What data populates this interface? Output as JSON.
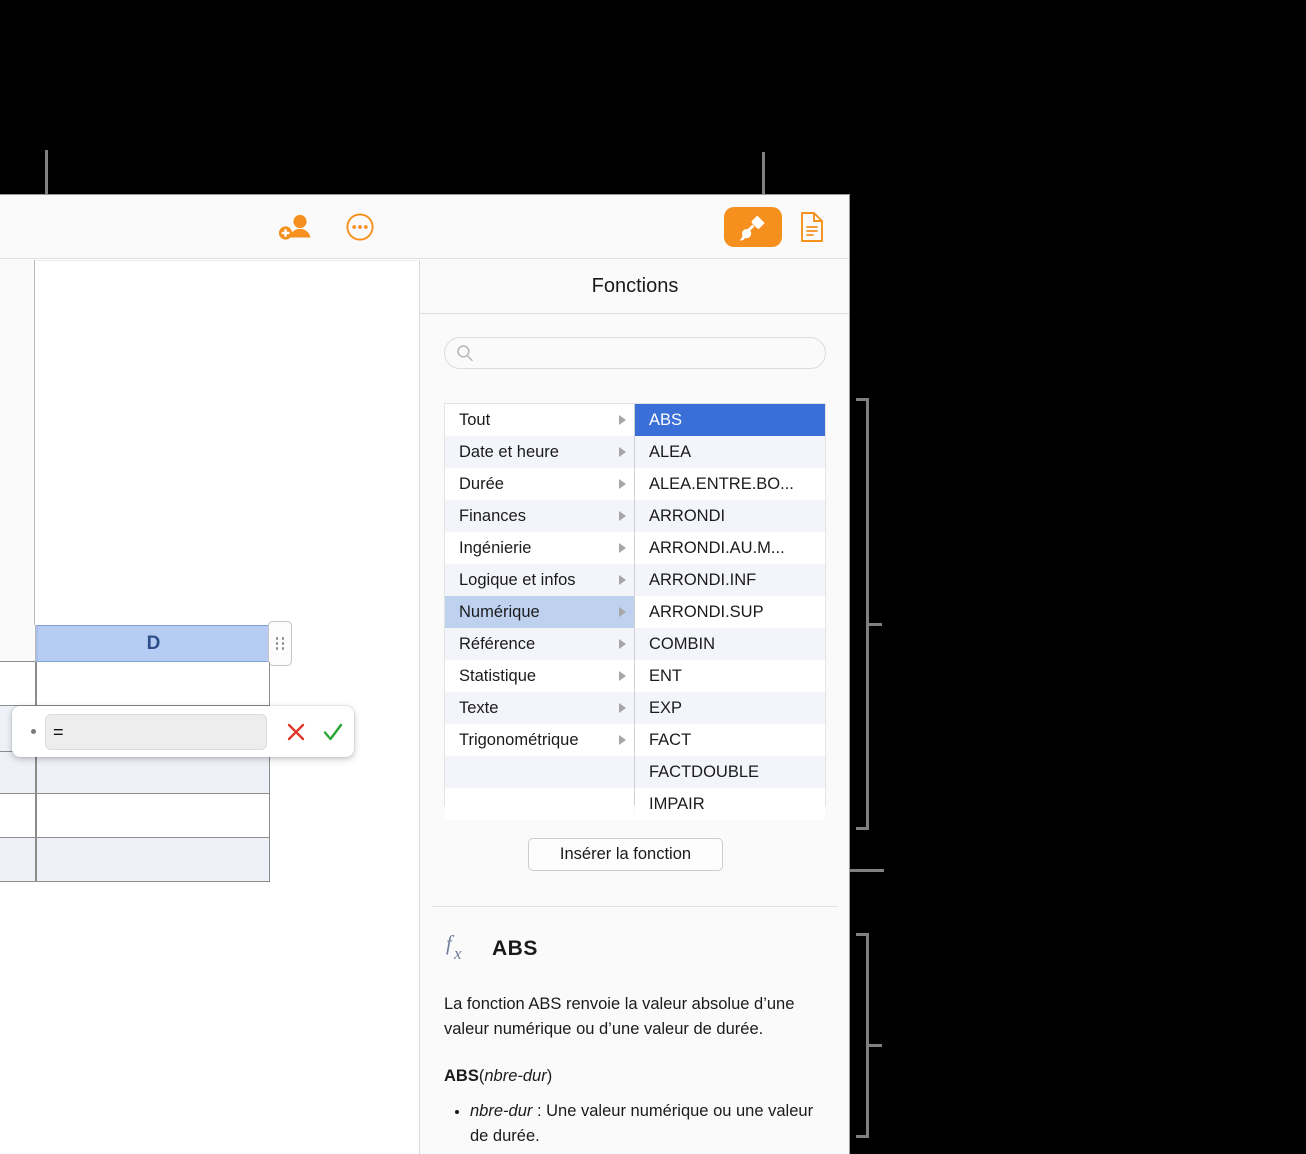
{
  "toolbar": {
    "share_icon": "add-person-icon",
    "more_icon": "ellipsis-circle-icon",
    "format_icon": "paintbrush-icon",
    "document_icon": "document-icon"
  },
  "sheet": {
    "selected_column_label": "D",
    "column_handle_icon": "drag-dots-icon"
  },
  "formula_editor": {
    "value": "=",
    "cancel_icon": "x-mark-icon",
    "accept_icon": "checkmark-icon",
    "cancel_color": "#e0392e",
    "accept_color": "#2aa535"
  },
  "panel": {
    "title": "Fonctions",
    "search": {
      "placeholder": "",
      "value": "",
      "icon": "search-icon"
    },
    "categories": [
      "Tout",
      "Date et heure",
      "Durée",
      "Finances",
      "Ingénierie",
      "Logique et infos",
      "Numérique",
      "Référence",
      "Statistique",
      "Texte",
      "Trigonométrique"
    ],
    "selected_category": "Numérique",
    "functions": [
      "ABS",
      "ALEA",
      "ALEA.ENTRE.BO...",
      "ARRONDI",
      "ARRONDI.AU.M...",
      "ARRONDI.INF",
      "ARRONDI.SUP",
      "COMBIN",
      "ENT",
      "EXP",
      "FACT",
      "FACTDOUBLE",
      "IMPAIR"
    ],
    "selected_function": "ABS",
    "insert_button_label": "Insérer la fonction"
  },
  "description": {
    "fx_icon": "fx-icon",
    "name": "ABS",
    "summary": "La fonction ABS renvoie la valeur absolue d’une valeur numérique ou d’une valeur de durée.",
    "signature_name": "ABS",
    "signature_open": "(",
    "signature_arg": "nbre-dur",
    "signature_close": ")",
    "arg_name": "nbre-dur",
    "arg_sep": " : ",
    "arg_desc": "Une valeur numérique ou une valeur de durée."
  },
  "colors": {
    "accent_orange": "#F5901E",
    "selection_blue": "#3a6fd8",
    "category_blue": "#bed2f0",
    "column_header_blue": "#b6ccf2",
    "leader_gray": "#808080"
  }
}
